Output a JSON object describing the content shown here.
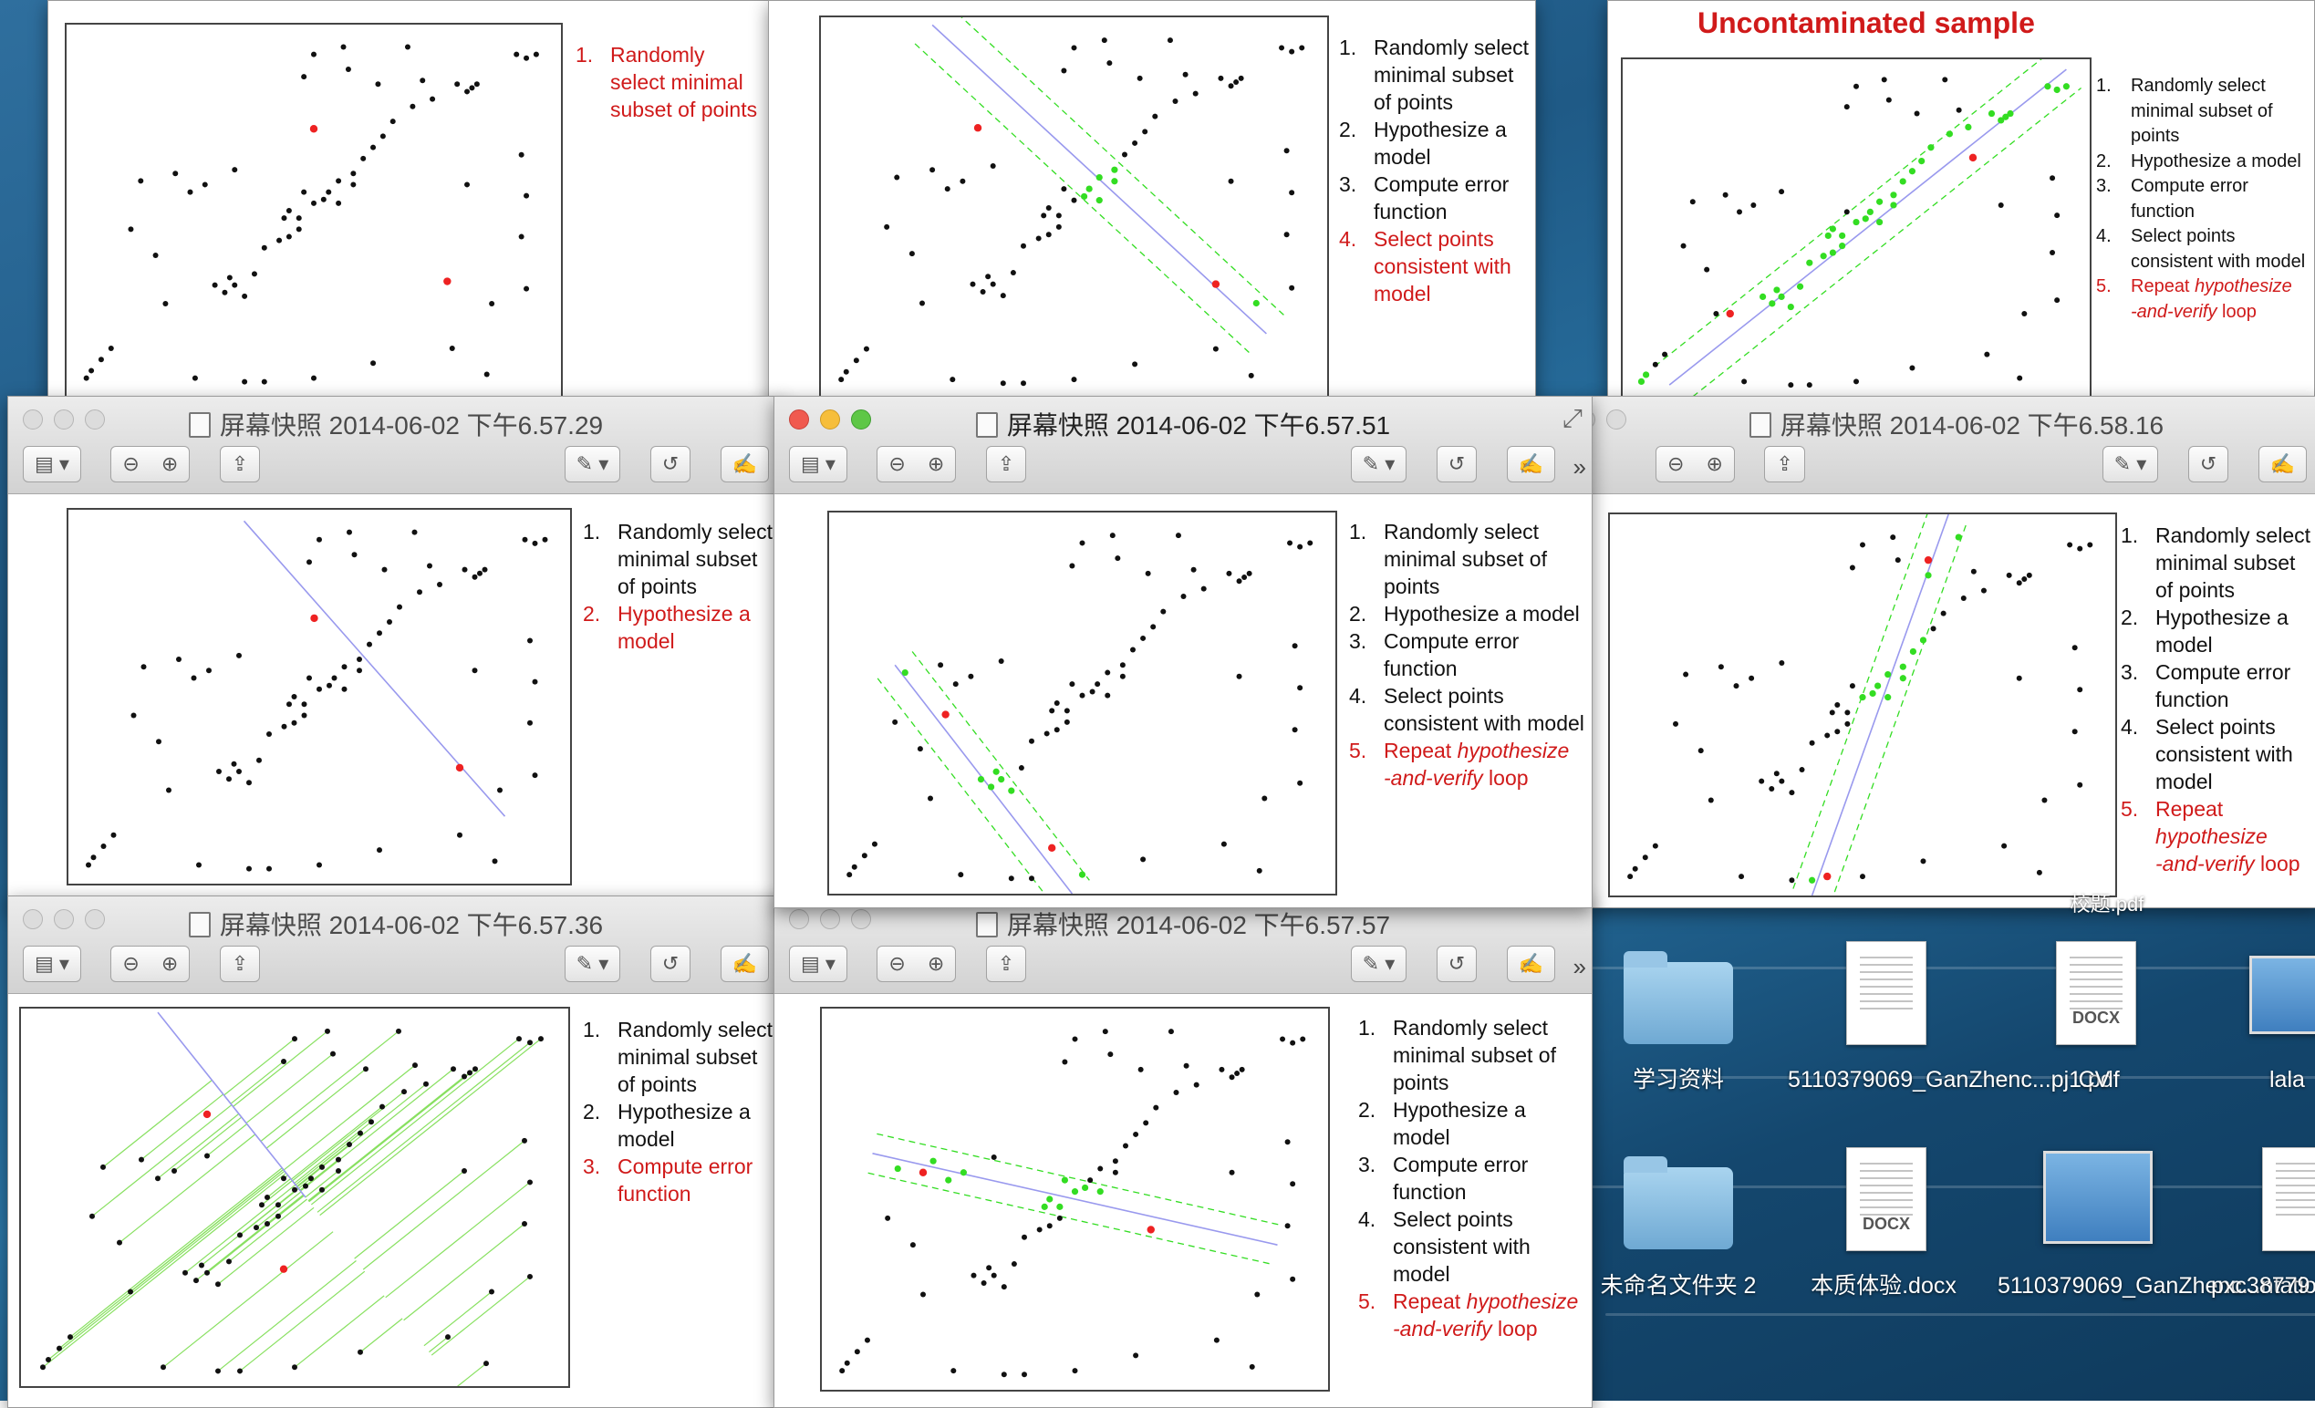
{
  "windows": {
    "top_left": {
      "steps": [
        "Randomly select minimal subset of points"
      ],
      "active_step": 1
    },
    "top_mid": {
      "steps": [
        "Randomly select minimal subset of points",
        "Hypothesize a model",
        "Compute error function",
        "Select points consistent with model"
      ],
      "active_step": 4
    },
    "top_right": {
      "heading": "Uncontaminated sample",
      "steps": [
        "Randomly select minimal subset of points",
        "Hypothesize a model",
        "Compute error function",
        "Select points consistent with model"
      ],
      "repeat": {
        "a": "Repeat",
        "b": "hypothesize",
        "c": "-and-verify",
        "d": "loop"
      },
      "active_step": 5
    },
    "mid_left": {
      "title": "屏幕快照 2014-06-02 下午6.57.29",
      "steps": [
        "Randomly select minimal subset of points",
        "Hypothesize a model"
      ],
      "active_step": 2
    },
    "mid_center": {
      "title": "屏幕快照 2014-06-02 下午6.57.51",
      "steps": [
        "Randomly select minimal subset of points",
        "Hypothesize a model",
        "Compute error function",
        "Select points consistent with model"
      ],
      "repeat": {
        "a": "Repeat",
        "b": "hypothesize",
        "c": "-and-verify",
        "d": "loop"
      },
      "active_step": 5
    },
    "mid_right": {
      "title": "屏幕快照 2014-06-02 下午6.58.16",
      "steps": [
        "Randomly select minimal subset of points",
        "Hypothesize a model",
        "Compute error function",
        "Select points consistent with model"
      ],
      "repeat": {
        "a": "Repeat",
        "b": "hypothesize",
        "c": "-and-verify",
        "d": "loop"
      },
      "active_step": 5
    },
    "bot_left": {
      "title": "屏幕快照 2014-06-02 下午6.57.36",
      "steps": [
        "Randomly select minimal subset of points",
        "Hypothesize a model",
        "Compute error function"
      ],
      "active_step": 3
    },
    "bot_mid": {
      "title": "屏幕快照 2014-06-02 下午6.57.57",
      "steps": [
        "Randomly select minimal subset of points",
        "Hypothesize a model",
        "Compute error function",
        "Select points consistent with model"
      ],
      "repeat": {
        "a": "Repeat",
        "b": "hypothesize",
        "c": "-and-verify",
        "d": "loop"
      },
      "active_step": 5
    }
  },
  "desktop": {
    "partial_top_label": "校题.pdf",
    "icons": [
      {
        "label": "学习资料",
        "type": "folder"
      },
      {
        "label": "5110379069_GanZhenc...pj1.pdf",
        "type": "pdf"
      },
      {
        "label": "CV",
        "type": "docx",
        "badge": "DOCX"
      },
      {
        "label": "lala",
        "type": "monitor"
      },
      {
        "label": "未命名文件夹 2",
        "type": "folder"
      },
      {
        "label": "本质体验.docx",
        "type": "docx",
        "badge": "DOCX"
      },
      {
        "label": "5110379069_GanZhenc...ntation",
        "type": "monitor"
      },
      {
        "label": "pxc38779",
        "type": "pdf"
      }
    ]
  },
  "colors": {
    "active_text": "#d01a1a",
    "inlier": "#33dd22",
    "model_line": "#9999ee",
    "sample_point": "#ee2222",
    "error_line": "#88e060"
  }
}
